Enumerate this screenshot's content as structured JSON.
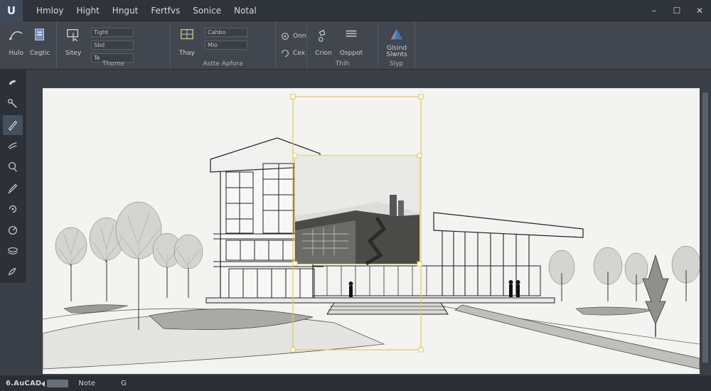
{
  "app": {
    "logo": "U",
    "status_name": "6.AuCAD"
  },
  "menu": [
    "Hmloy",
    "Hight",
    "Hngut",
    "Fertfvs",
    "Sonice",
    "Notal"
  ],
  "window_controls": {
    "minimize": "–",
    "maximize": "☐",
    "close": "✕"
  },
  "ribbon": {
    "groups": [
      {
        "tools": [
          {
            "label": "Hulo",
            "icon": "curve-icon"
          },
          {
            "label": "Cegtic",
            "icon": "layers-icon"
          }
        ],
        "name": ""
      },
      {
        "tools": [
          {
            "label": "Sitey",
            "icon": "pointer-icon"
          }
        ],
        "fields": [
          "Tight",
          "Sbd",
          "Te"
        ],
        "name": "Thome"
      },
      {
        "tools": [
          {
            "label": "Thay",
            "icon": "grid-icon"
          }
        ],
        "fields": [
          "Cahbo",
          "Mio"
        ],
        "name": "Astte Apfora"
      },
      {
        "tools": [
          {
            "label": "Onn",
            "icon": "eye-icon"
          },
          {
            "label": "Cex",
            "icon": "loop-icon"
          }
        ],
        "name": ""
      },
      {
        "tools": [
          {
            "label": "Crion",
            "icon": "lasso-icon"
          },
          {
            "label": "Osppot",
            "icon": "list-icon"
          }
        ],
        "name": "Thih"
      },
      {
        "tools": [
          {
            "label": "Glsind Slwnts",
            "icon": "pyramid-icon"
          }
        ],
        "name": "Slyp"
      }
    ]
  },
  "left_tools": [
    "hand-icon",
    "select-icon",
    "pen-icon",
    "brush-icon",
    "lasso-icon",
    "pencil-icon",
    "rotate-icon",
    "orbit-icon",
    "layers-icon",
    "paint-icon"
  ],
  "status": {
    "items": [
      "Note",
      "G"
    ]
  },
  "colors": {
    "accent": "#e2c85a",
    "toolbar": "#2d3137",
    "canvas": "#f3f3f1"
  }
}
